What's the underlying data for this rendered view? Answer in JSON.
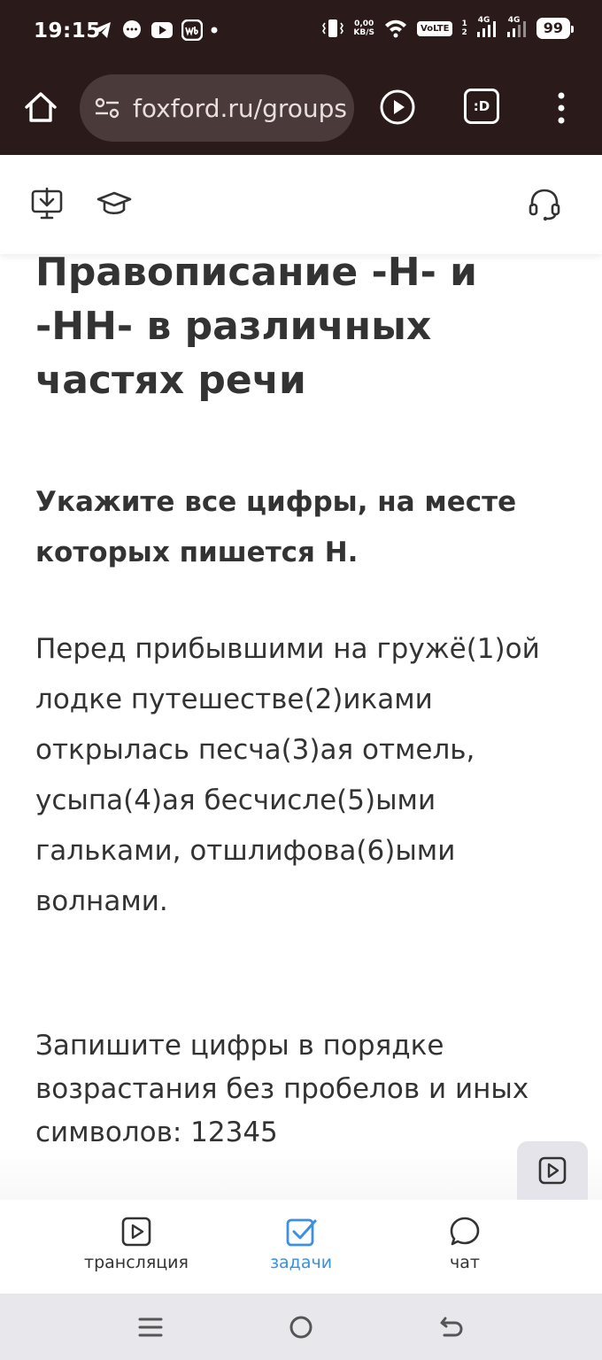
{
  "status_bar": {
    "time": "19:15",
    "net_speed_value": "0,00",
    "net_speed_unit": "KB/S",
    "volte": "VoLTE",
    "sim1": "1",
    "sim2": "2",
    "network1": "4G",
    "network2": "4G",
    "battery": "99"
  },
  "browser": {
    "url": "foxford.ru/groups",
    "extension_label": ":D"
  },
  "lesson": {
    "title": "Правописание -Н- и -НН- в различных частях речи"
  },
  "task": {
    "instruction": "Укажите все цифры, на месте которых пишется Н.",
    "text": "Перед прибывшими на гружё(1)ой лодке путешестве(2)иками открылась песча(3)ая отмель, усыпа(4)ая бесчисле(5)ыми гальками, отшлифова(6)ыми волнами.",
    "answer_format": "Запишите цифры в порядке возрастания без пробелов и иных символов: 12345"
  },
  "bottom_nav": {
    "items": [
      {
        "label": "трансляция",
        "icon": "play-square-icon",
        "active": false
      },
      {
        "label": "задачи",
        "icon": "checkbox-icon",
        "active": true
      },
      {
        "label": "чат",
        "icon": "chat-bubble-icon",
        "active": false
      }
    ]
  },
  "colors": {
    "chrome_bg": "#2a1a1a",
    "url_pill_bg": "#4a3a3a",
    "text": "#333333",
    "accent": "#3d8fe0",
    "system_nav_bg": "#e8e8ec"
  }
}
